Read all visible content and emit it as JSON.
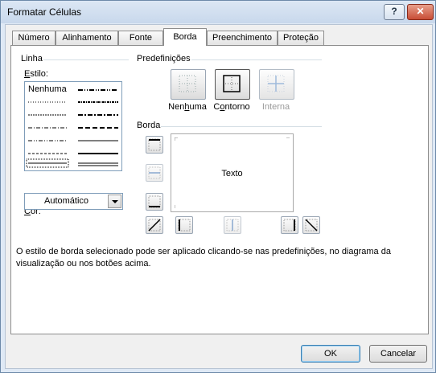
{
  "window": {
    "title": "Formatar Células",
    "help_label": "?",
    "close_label": "✕"
  },
  "tabs": [
    {
      "label": "Número",
      "active": false
    },
    {
      "label": "Alinhamento",
      "active": false
    },
    {
      "label": "Fonte",
      "active": false
    },
    {
      "label": "Borda",
      "active": true
    },
    {
      "label": "Preenchimento",
      "active": false
    },
    {
      "label": "Proteção",
      "active": false
    }
  ],
  "linha": {
    "group_label": "Linha",
    "estilo_label_u": "E",
    "estilo_label_rest": "stilo:",
    "none_label": "Nenhuma",
    "cor_label_u": "C",
    "cor_label_rest": "or:",
    "cor_value": "Automático"
  },
  "predefinicoes": {
    "group_label": "Predefinições",
    "items": [
      {
        "label_a": "Nen",
        "label_u": "h",
        "label_b": "uma",
        "enabled": true,
        "icon": "border-none-icon"
      },
      {
        "label_a": "C",
        "label_u": "o",
        "label_b": "ntorno",
        "enabled": true,
        "icon": "border-outline-icon"
      },
      {
        "label_a": "",
        "label_u": "",
        "label_b": "Interna",
        "enabled": false,
        "icon": "border-inside-icon"
      }
    ]
  },
  "borda": {
    "group_label": "Borda",
    "preview_text": "Texto"
  },
  "hint_text": "O estilo de borda selecionado pode ser aplicado clicando-se nas predefinições, no diagrama da visualização ou nos botões acima.",
  "buttons": {
    "ok": "OK",
    "cancel": "Cancelar"
  },
  "colors": {
    "accent": "#3c7fb1",
    "window_frame": "#6d8aa9",
    "close": "#c84d36"
  }
}
